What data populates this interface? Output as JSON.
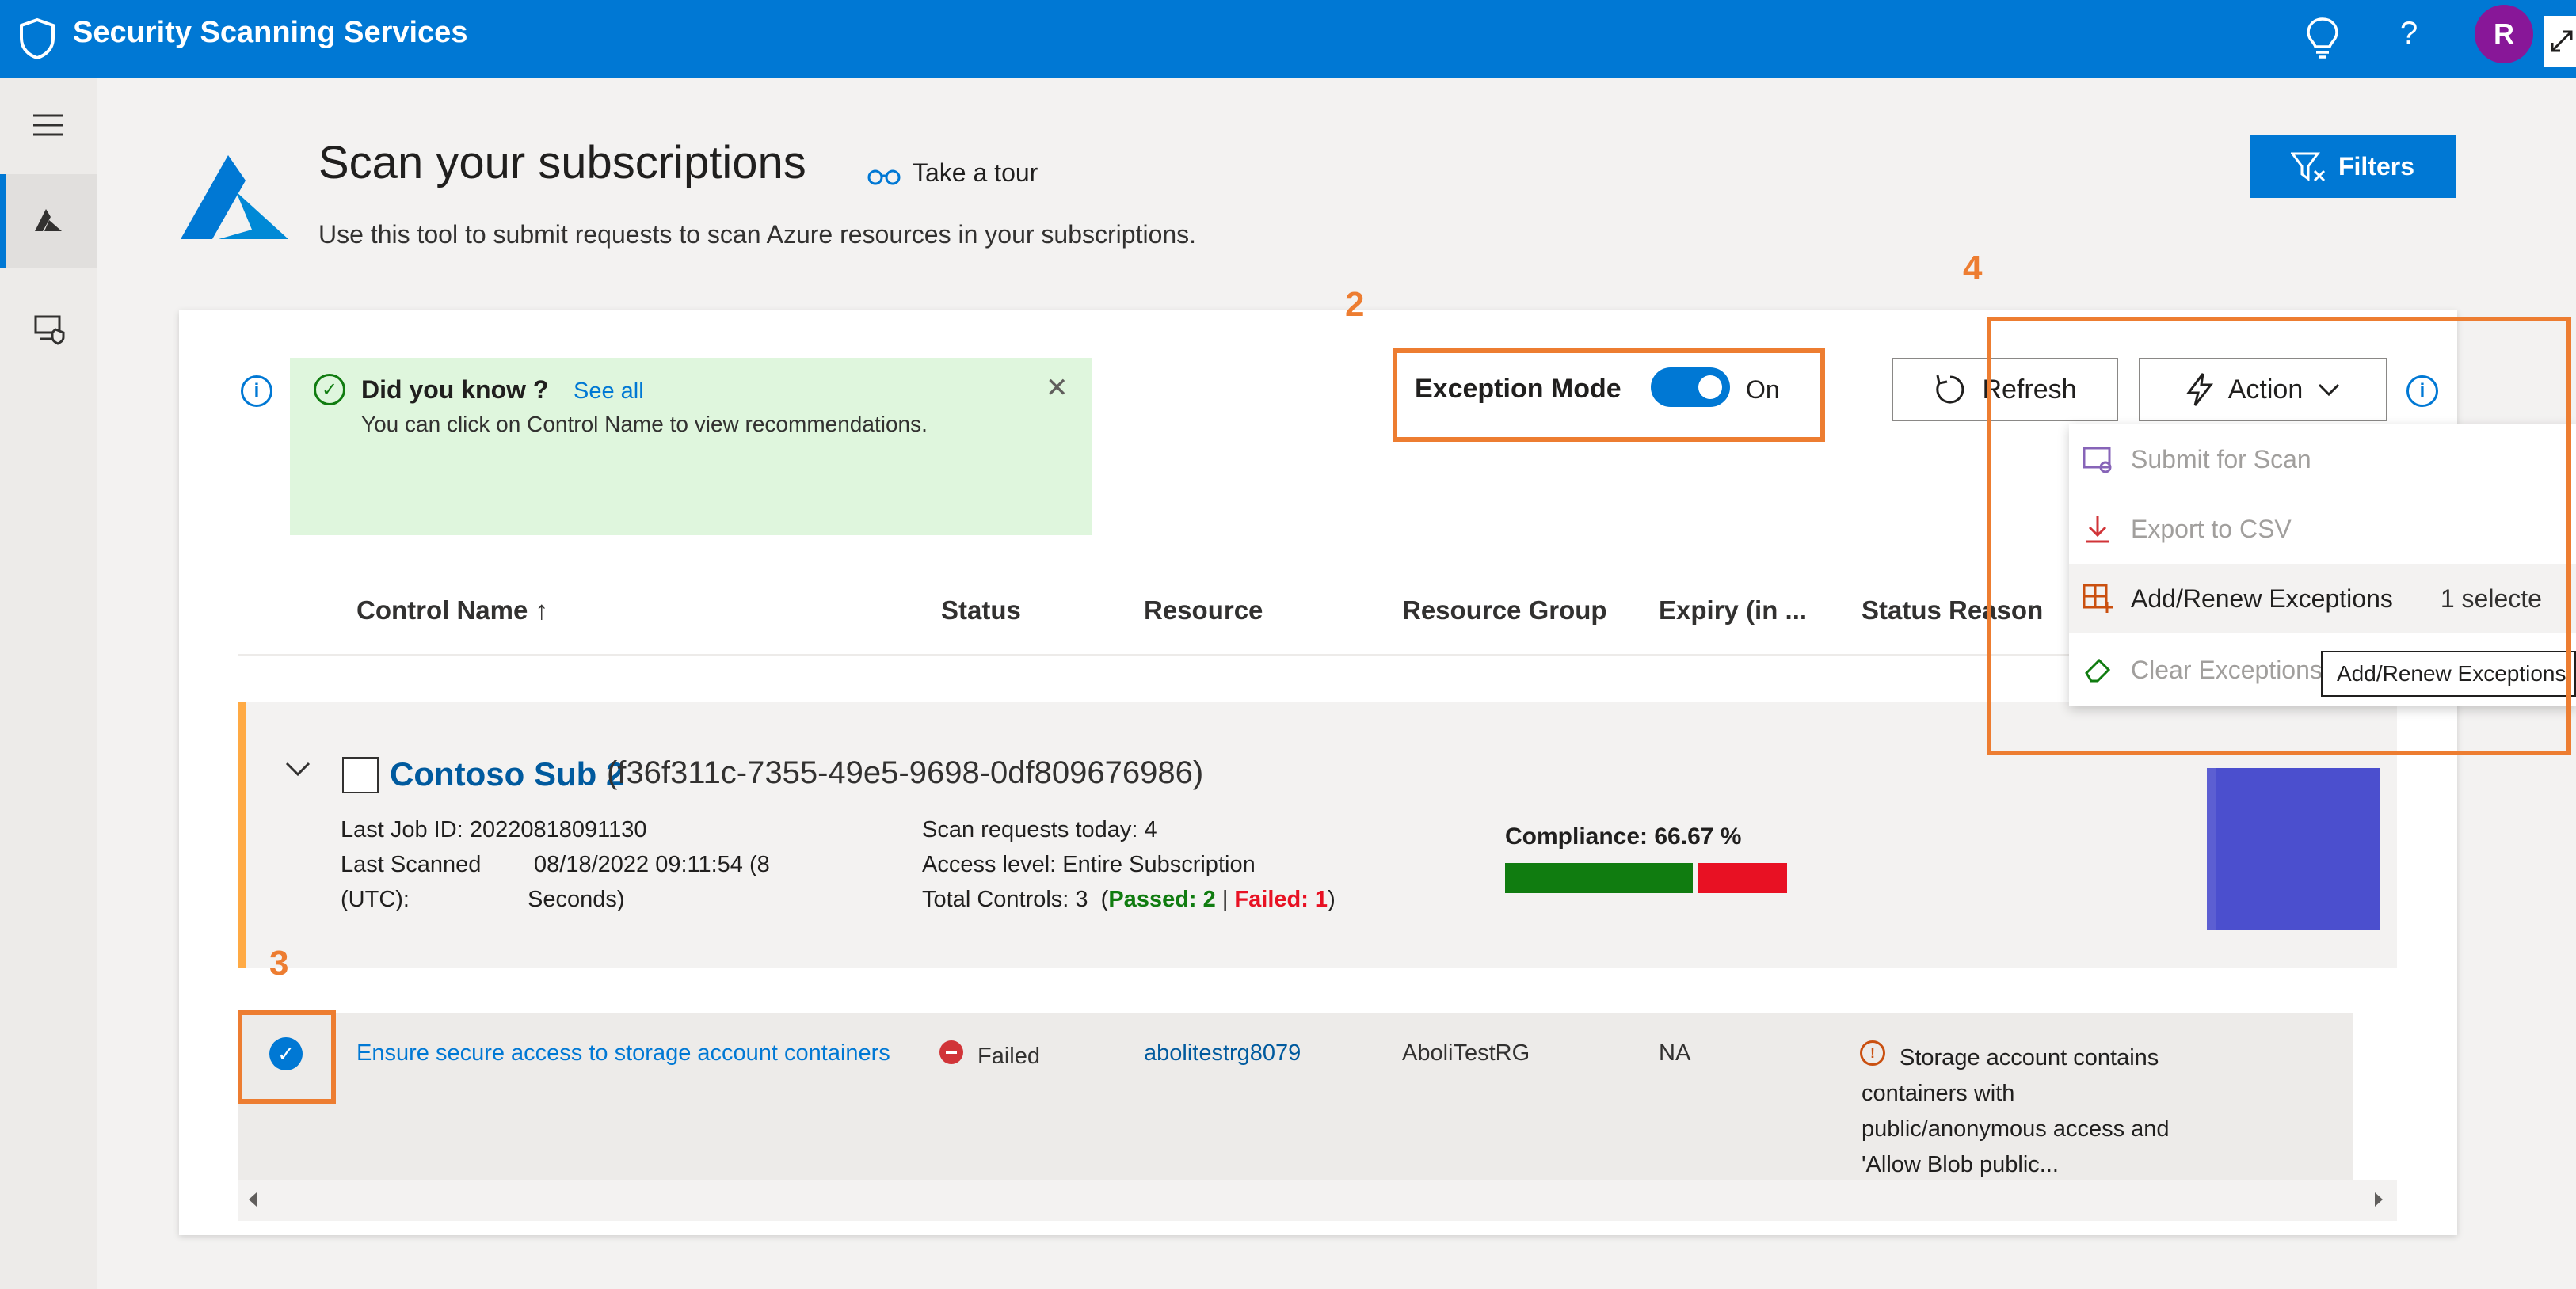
{
  "app": {
    "title": "Security Scanning Services"
  },
  "header_icons": {
    "lightbulb": "lightbulb-icon",
    "help_text": "?",
    "avatar_initial": "R",
    "avatar_color": "#881798"
  },
  "page": {
    "title": "Scan your subscriptions",
    "tour_label": "Take a tour",
    "subtitle": "Use this tool to submit requests to scan Azure resources in your subscriptions.",
    "filters_label": "Filters"
  },
  "tip": {
    "title": "Did you know ?",
    "link": "See all",
    "body": "You can click on Control Name to view recommendations."
  },
  "exception_mode": {
    "label": "Exception Mode",
    "state": "On"
  },
  "toolbar": {
    "refresh_label": "Refresh",
    "action_label": "Action"
  },
  "action_menu": {
    "items": [
      {
        "label": "Submit for Scan",
        "enabled": false
      },
      {
        "label": "Export to CSV",
        "enabled": false
      },
      {
        "label": "Add/Renew Exceptions",
        "enabled": true,
        "badge": "1 selecte"
      },
      {
        "label": "Clear Exceptions",
        "enabled": false
      }
    ],
    "tooltip": "Add/Renew Exceptions"
  },
  "columns": [
    "Control Name ↑",
    "Status",
    "Resource",
    "Resource Group",
    "Expiry (in ...",
    "Status Reason"
  ],
  "subscription": {
    "name": "Contoso Sub 2",
    "id": "(f36f311c-7355-49e5-9698-0df809676986)",
    "last_job_id_label": "Last Job ID:",
    "last_job_id": "20220818091130",
    "last_scanned_label": "Last Scanned",
    "last_scanned_value": "08/18/2022 09:11:54 (8",
    "utc_label": "(UTC):",
    "seconds_label": "Seconds)",
    "scan_requests_label": "Scan requests today:",
    "scan_requests": "4",
    "access_level_label": "Access level:",
    "access_level": "Entire Subscription",
    "total_controls_label": "Total Controls:",
    "total_controls": "3",
    "passed_label": "Passed: 2",
    "failed_label": "Failed: 1",
    "compliance_label": "Compliance:",
    "compliance_value": "66.67 %",
    "compliance_fraction": 0.6667
  },
  "row": {
    "control_name": "Ensure secure access to storage account containers",
    "status": "Failed",
    "resource": "abolitestrg8079",
    "resource_group": "AboliTestRG",
    "expiry": "NA",
    "status_reason": "Storage account contains containers with public/anonymous access and 'Allow Blob public..."
  },
  "annotations": [
    "2",
    "3",
    "4"
  ],
  "colors": {
    "accent": "#0078d4",
    "annotation": "#ed7d31",
    "pass": "#107c10",
    "fail": "#e81123"
  }
}
